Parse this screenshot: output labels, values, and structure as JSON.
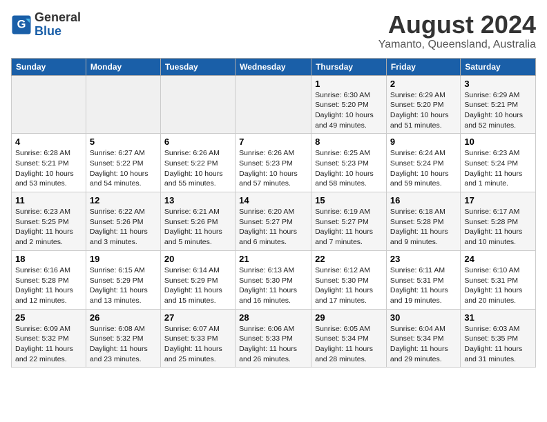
{
  "header": {
    "logo_general": "General",
    "logo_blue": "Blue",
    "month_year": "August 2024",
    "location": "Yamanto, Queensland, Australia"
  },
  "days_of_week": [
    "Sunday",
    "Monday",
    "Tuesday",
    "Wednesday",
    "Thursday",
    "Friday",
    "Saturday"
  ],
  "weeks": [
    [
      {
        "day": "",
        "info": ""
      },
      {
        "day": "",
        "info": ""
      },
      {
        "day": "",
        "info": ""
      },
      {
        "day": "",
        "info": ""
      },
      {
        "day": "1",
        "info": "Sunrise: 6:30 AM\nSunset: 5:20 PM\nDaylight: 10 hours\nand 49 minutes."
      },
      {
        "day": "2",
        "info": "Sunrise: 6:29 AM\nSunset: 5:20 PM\nDaylight: 10 hours\nand 51 minutes."
      },
      {
        "day": "3",
        "info": "Sunrise: 6:29 AM\nSunset: 5:21 PM\nDaylight: 10 hours\nand 52 minutes."
      }
    ],
    [
      {
        "day": "4",
        "info": "Sunrise: 6:28 AM\nSunset: 5:21 PM\nDaylight: 10 hours\nand 53 minutes."
      },
      {
        "day": "5",
        "info": "Sunrise: 6:27 AM\nSunset: 5:22 PM\nDaylight: 10 hours\nand 54 minutes."
      },
      {
        "day": "6",
        "info": "Sunrise: 6:26 AM\nSunset: 5:22 PM\nDaylight: 10 hours\nand 55 minutes."
      },
      {
        "day": "7",
        "info": "Sunrise: 6:26 AM\nSunset: 5:23 PM\nDaylight: 10 hours\nand 57 minutes."
      },
      {
        "day": "8",
        "info": "Sunrise: 6:25 AM\nSunset: 5:23 PM\nDaylight: 10 hours\nand 58 minutes."
      },
      {
        "day": "9",
        "info": "Sunrise: 6:24 AM\nSunset: 5:24 PM\nDaylight: 10 hours\nand 59 minutes."
      },
      {
        "day": "10",
        "info": "Sunrise: 6:23 AM\nSunset: 5:24 PM\nDaylight: 11 hours\nand 1 minute."
      }
    ],
    [
      {
        "day": "11",
        "info": "Sunrise: 6:23 AM\nSunset: 5:25 PM\nDaylight: 11 hours\nand 2 minutes."
      },
      {
        "day": "12",
        "info": "Sunrise: 6:22 AM\nSunset: 5:26 PM\nDaylight: 11 hours\nand 3 minutes."
      },
      {
        "day": "13",
        "info": "Sunrise: 6:21 AM\nSunset: 5:26 PM\nDaylight: 11 hours\nand 5 minutes."
      },
      {
        "day": "14",
        "info": "Sunrise: 6:20 AM\nSunset: 5:27 PM\nDaylight: 11 hours\nand 6 minutes."
      },
      {
        "day": "15",
        "info": "Sunrise: 6:19 AM\nSunset: 5:27 PM\nDaylight: 11 hours\nand 7 minutes."
      },
      {
        "day": "16",
        "info": "Sunrise: 6:18 AM\nSunset: 5:28 PM\nDaylight: 11 hours\nand 9 minutes."
      },
      {
        "day": "17",
        "info": "Sunrise: 6:17 AM\nSunset: 5:28 PM\nDaylight: 11 hours\nand 10 minutes."
      }
    ],
    [
      {
        "day": "18",
        "info": "Sunrise: 6:16 AM\nSunset: 5:28 PM\nDaylight: 11 hours\nand 12 minutes."
      },
      {
        "day": "19",
        "info": "Sunrise: 6:15 AM\nSunset: 5:29 PM\nDaylight: 11 hours\nand 13 minutes."
      },
      {
        "day": "20",
        "info": "Sunrise: 6:14 AM\nSunset: 5:29 PM\nDaylight: 11 hours\nand 15 minutes."
      },
      {
        "day": "21",
        "info": "Sunrise: 6:13 AM\nSunset: 5:30 PM\nDaylight: 11 hours\nand 16 minutes."
      },
      {
        "day": "22",
        "info": "Sunrise: 6:12 AM\nSunset: 5:30 PM\nDaylight: 11 hours\nand 17 minutes."
      },
      {
        "day": "23",
        "info": "Sunrise: 6:11 AM\nSunset: 5:31 PM\nDaylight: 11 hours\nand 19 minutes."
      },
      {
        "day": "24",
        "info": "Sunrise: 6:10 AM\nSunset: 5:31 PM\nDaylight: 11 hours\nand 20 minutes."
      }
    ],
    [
      {
        "day": "25",
        "info": "Sunrise: 6:09 AM\nSunset: 5:32 PM\nDaylight: 11 hours\nand 22 minutes."
      },
      {
        "day": "26",
        "info": "Sunrise: 6:08 AM\nSunset: 5:32 PM\nDaylight: 11 hours\nand 23 minutes."
      },
      {
        "day": "27",
        "info": "Sunrise: 6:07 AM\nSunset: 5:33 PM\nDaylight: 11 hours\nand 25 minutes."
      },
      {
        "day": "28",
        "info": "Sunrise: 6:06 AM\nSunset: 5:33 PM\nDaylight: 11 hours\nand 26 minutes."
      },
      {
        "day": "29",
        "info": "Sunrise: 6:05 AM\nSunset: 5:34 PM\nDaylight: 11 hours\nand 28 minutes."
      },
      {
        "day": "30",
        "info": "Sunrise: 6:04 AM\nSunset: 5:34 PM\nDaylight: 11 hours\nand 29 minutes."
      },
      {
        "day": "31",
        "info": "Sunrise: 6:03 AM\nSunset: 5:35 PM\nDaylight: 11 hours\nand 31 minutes."
      }
    ]
  ]
}
